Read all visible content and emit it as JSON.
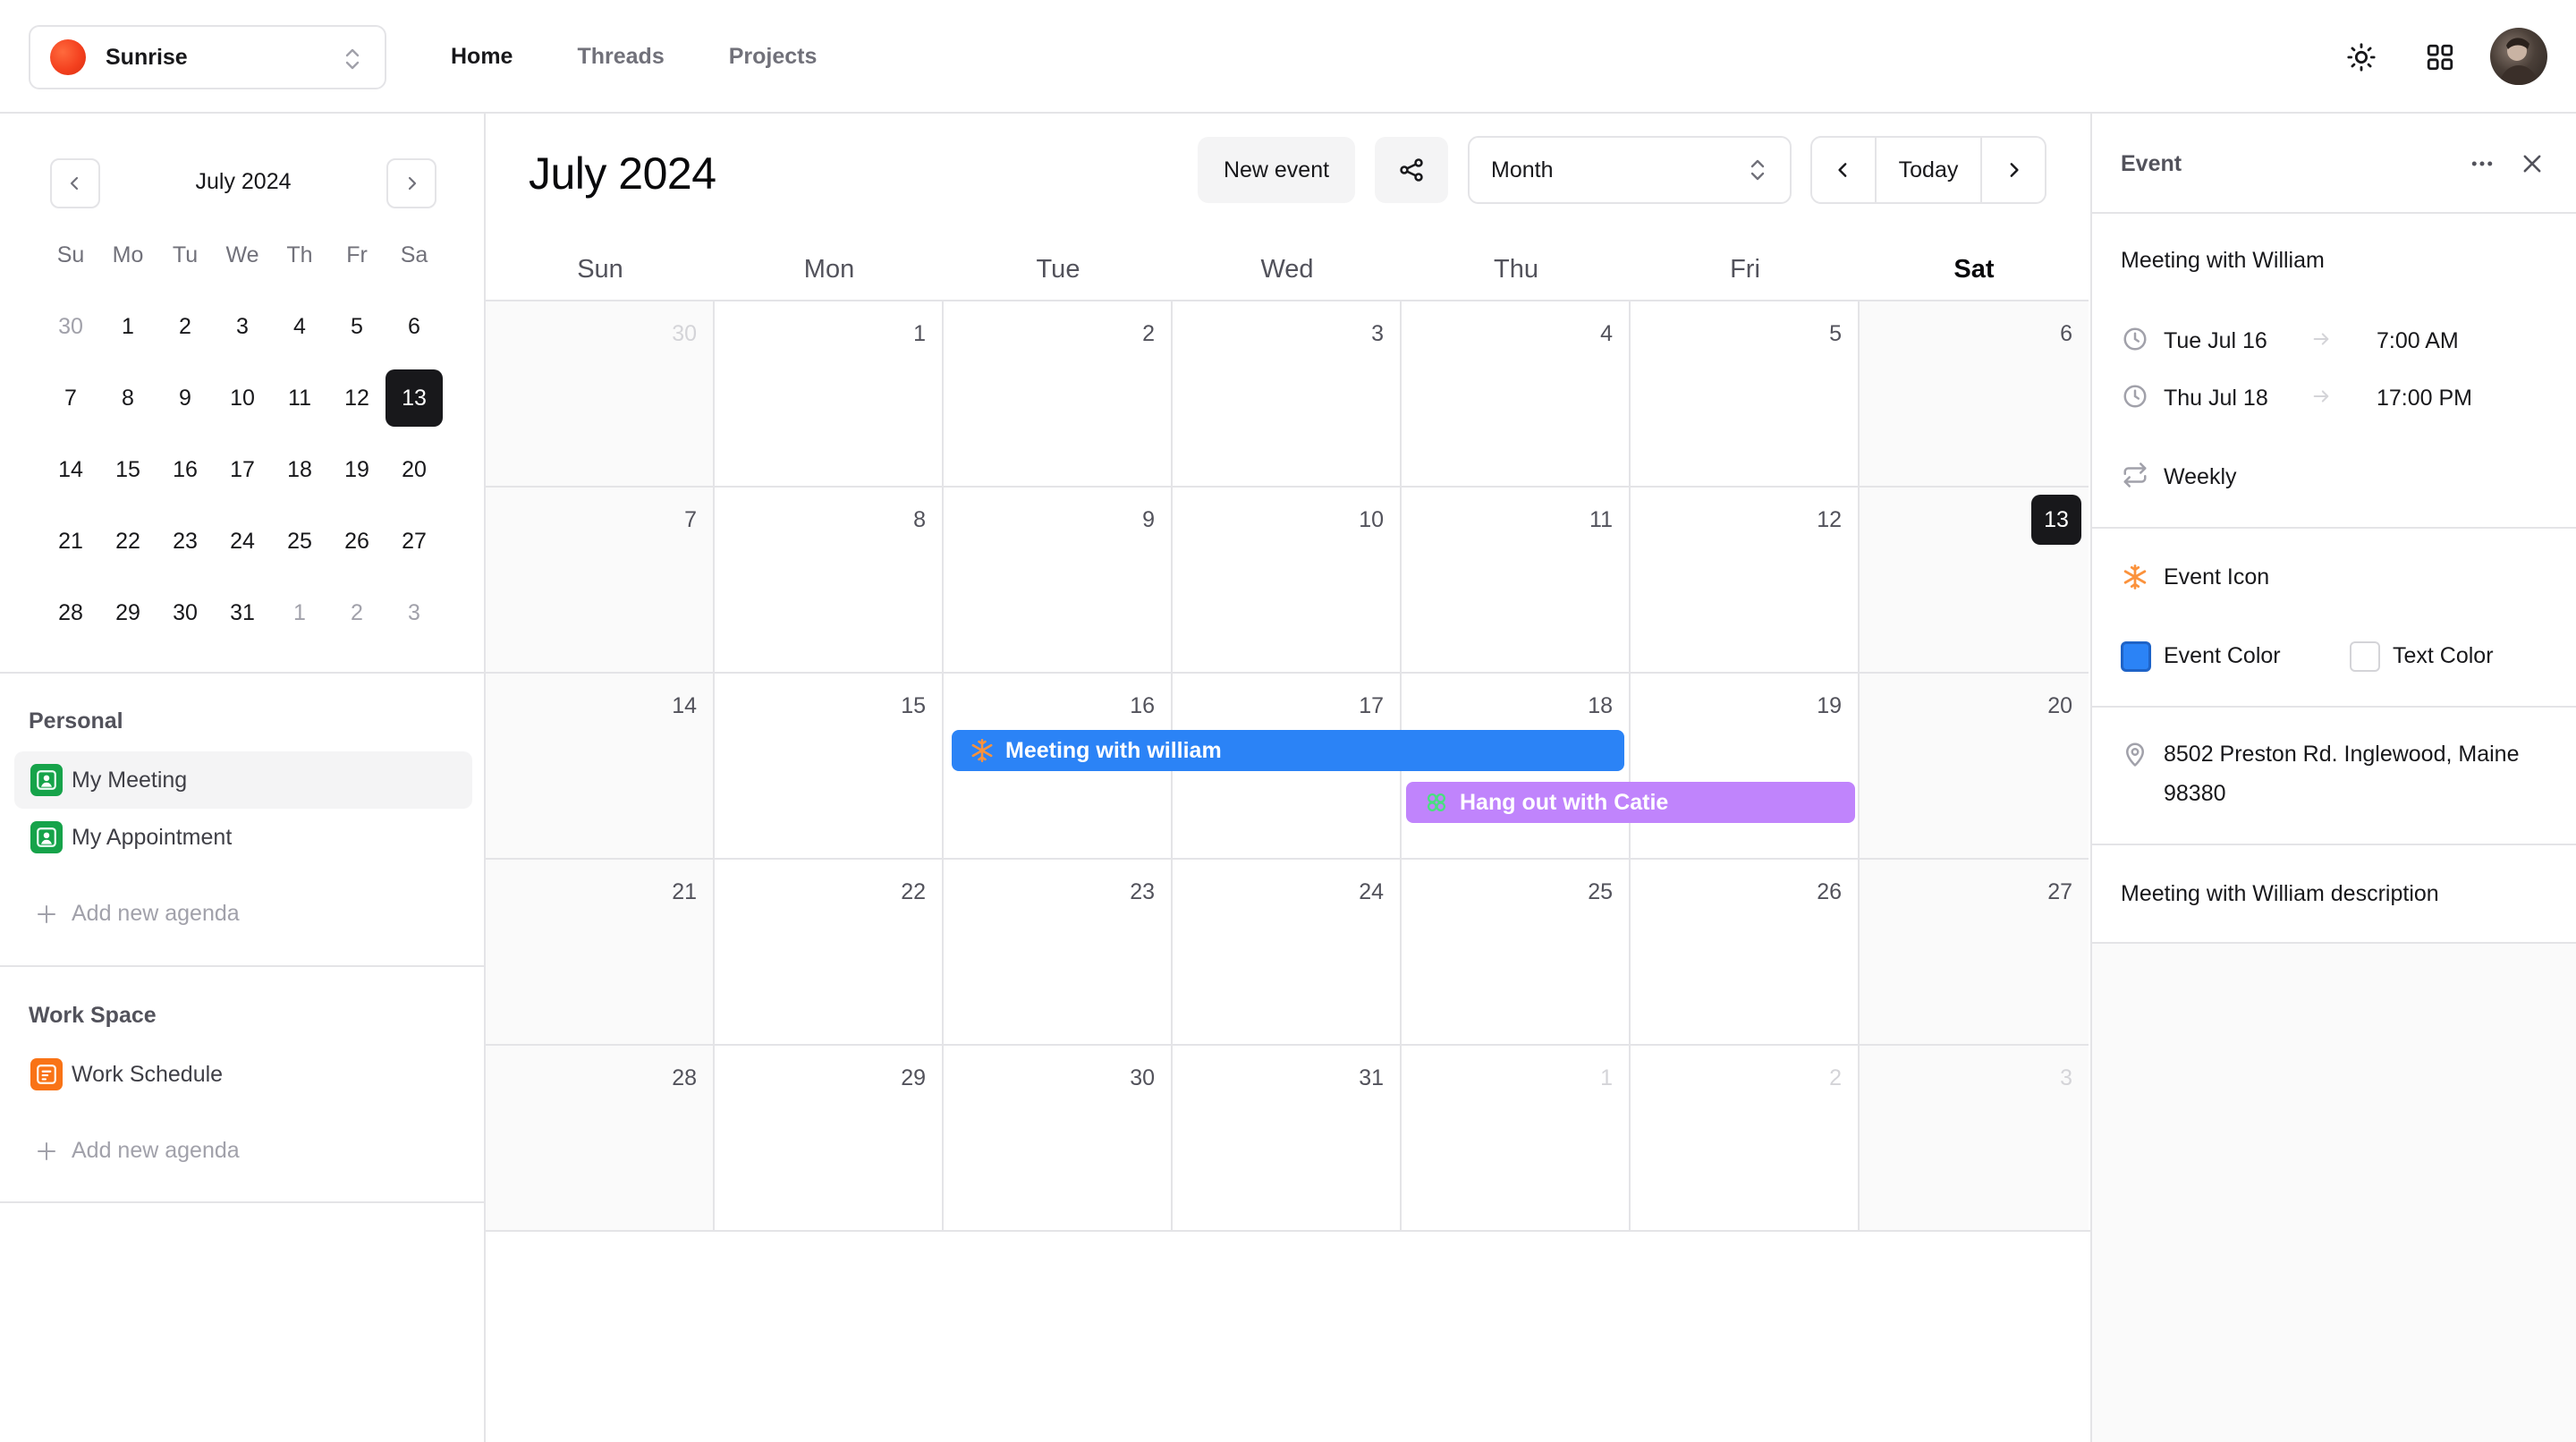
{
  "app": {
    "workspace_name": "Sunrise",
    "nav": [
      {
        "label": "Home",
        "active": true
      },
      {
        "label": "Threads",
        "active": false
      },
      {
        "label": "Projects",
        "active": false
      }
    ],
    "icons": [
      "sun-icon",
      "grid-icon",
      "avatar"
    ]
  },
  "mini_calendar": {
    "title": "July 2024",
    "weekdays": [
      "Su",
      "Mo",
      "Tu",
      "We",
      "Th",
      "Fr",
      "Sa"
    ],
    "weeks": [
      [
        "30",
        "1",
        "2",
        "3",
        "4",
        "5",
        "6"
      ],
      [
        "7",
        "8",
        "9",
        "10",
        "11",
        "12",
        "13"
      ],
      [
        "14",
        "15",
        "16",
        "17",
        "18",
        "19",
        "20"
      ],
      [
        "21",
        "22",
        "23",
        "24",
        "25",
        "26",
        "27"
      ],
      [
        "28",
        "29",
        "30",
        "31",
        "1",
        "2",
        "3"
      ]
    ],
    "today": "13"
  },
  "sidebar": {
    "personal_title": "Personal",
    "personal_items": [
      {
        "label": "My Meeting",
        "selected": true,
        "color": "#16a34a"
      },
      {
        "label": "My Appointment",
        "selected": false,
        "color": "#16a34a"
      }
    ],
    "personal_add": "Add new agenda",
    "work_title": "Work Space",
    "work_items": [
      {
        "label": "Work Schedule",
        "selected": false,
        "color": "#f97316"
      }
    ],
    "work_add": "Add new agenda"
  },
  "calendar": {
    "title": "July 2024",
    "new_event_label": "New event",
    "view_value": "Month",
    "today_label": "Today",
    "weekdays": [
      "Sun",
      "Mon",
      "Tue",
      "Wed",
      "Thu",
      "Fri",
      "Sat"
    ],
    "weeks": [
      [
        "30",
        "1",
        "2",
        "3",
        "4",
        "5",
        "6"
      ],
      [
        "7",
        "8",
        "9",
        "10",
        "11",
        "12",
        "13"
      ],
      [
        "14",
        "15",
        "16",
        "17",
        "18",
        "19",
        "20"
      ],
      [
        "21",
        "22",
        "23",
        "24",
        "25",
        "26",
        "27"
      ],
      [
        "28",
        "29",
        "30",
        "31",
        "1",
        "2",
        "3"
      ]
    ],
    "events": [
      {
        "label": "Meeting with william",
        "color": "#2b83f6",
        "icon": "snowflake-icon"
      },
      {
        "label": "Hang out with Catie",
        "color": "#c084fc",
        "icon": "flower-icon"
      }
    ]
  },
  "event_panel": {
    "header": "Event",
    "title": "Meeting with William",
    "start_date": "Tue Jul 16",
    "start_time": "7:00 AM",
    "end_date": "Thu Jul 18",
    "end_time": "17:00 PM",
    "repeat": "Weekly",
    "icon_label": "Event Icon",
    "event_color_label": "Event Color",
    "event_color": "#2b83f6",
    "text_color_label": "Text Color",
    "location_line1": "8502 Preston Rd. Inglewood, Maine",
    "location_line2": "98380",
    "description": "Meeting with William description"
  }
}
